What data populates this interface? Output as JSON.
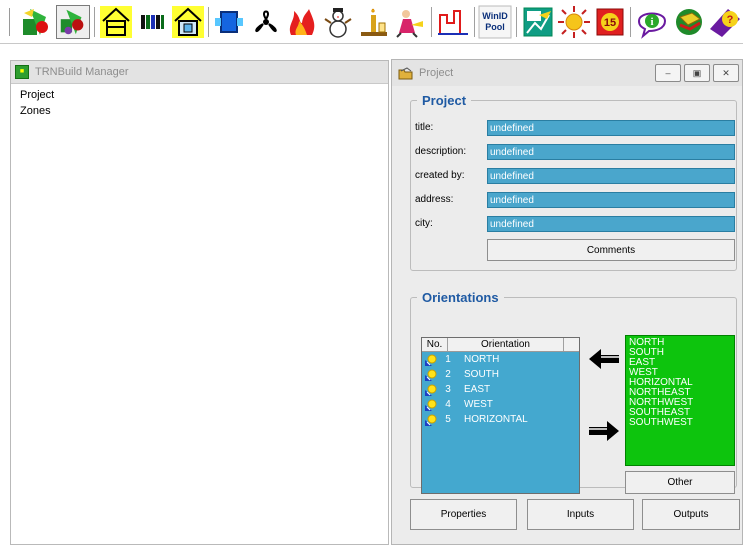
{
  "toolbar": {
    "buttons": [
      {
        "icon": "wizard-icon"
      },
      {
        "icon": "multi-wizard-icon"
      },
      {
        "icon": "building-icon"
      },
      {
        "icon": "layers-icon"
      },
      {
        "icon": "window-house-icon"
      },
      {
        "icon": "window-icon"
      },
      {
        "icon": "fan-icon"
      },
      {
        "icon": "heating-fire-icon"
      },
      {
        "icon": "snowman-icon"
      },
      {
        "icon": "lamp-icon"
      },
      {
        "icon": "people-icon"
      },
      {
        "icon": "schedule-icon"
      },
      {
        "icon": "winid-pool-icon",
        "line1": "WinID",
        "line2": "Pool"
      },
      {
        "icon": "chart-document-icon"
      },
      {
        "icon": "sun-icon"
      },
      {
        "icon": "calendar-15-icon",
        "label": "15"
      },
      {
        "icon": "info-icon"
      },
      {
        "icon": "book-icon"
      },
      {
        "icon": "help-icon"
      }
    ]
  },
  "manager": {
    "title": "TRNBuild Manager",
    "tree": [
      "Project",
      "Zones"
    ]
  },
  "project": {
    "title": "Project",
    "group_title": "Project",
    "fields": [
      {
        "label": "title:",
        "value": "undefined"
      },
      {
        "label": "description:",
        "value": "undefined"
      },
      {
        "label": "created by:",
        "value": "undefined"
      },
      {
        "label": "address:",
        "value": "undefined"
      },
      {
        "label": "city:",
        "value": "undefined"
      }
    ],
    "comments_label": "Comments"
  },
  "orientations": {
    "group_title": "Orientations",
    "columns": [
      "No.",
      "Orientation"
    ],
    "rows": [
      {
        "no": "1",
        "name": "NORTH"
      },
      {
        "no": "2",
        "name": "SOUTH"
      },
      {
        "no": "3",
        "name": "EAST"
      },
      {
        "no": "4",
        "name": "WEST"
      },
      {
        "no": "5",
        "name": "HORIZONTAL"
      }
    ],
    "available": [
      "NORTH",
      "SOUTH",
      "EAST",
      "WEST",
      "HORIZONTAL",
      "NORTHEAST",
      "NORTHWEST",
      "SOUTHEAST",
      "SOUTHWEST"
    ],
    "other_label": "Other"
  },
  "bottom_buttons": {
    "properties": "Properties",
    "inputs": "Inputs",
    "outputs": "Outputs"
  },
  "colors": {
    "field_bg": "#4aa6cc",
    "list_bg": "#44a8cf",
    "green_list": "#0dc40d",
    "group_title": "#1f5aa3"
  }
}
